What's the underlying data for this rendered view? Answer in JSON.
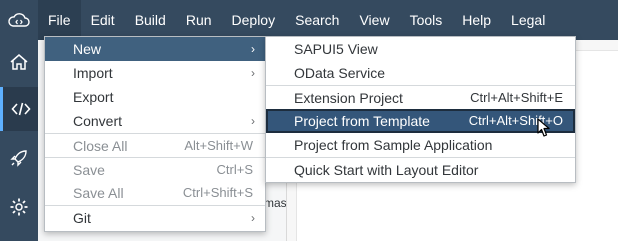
{
  "menubar": {
    "items": [
      "File",
      "Edit",
      "Build",
      "Run",
      "Deploy",
      "Search",
      "View",
      "Tools",
      "Help",
      "Legal"
    ]
  },
  "icons": {
    "logo": "cloud-code-icon",
    "sidebar": [
      "home-icon",
      "code-icon",
      "rocket-icon",
      "gear-icon"
    ]
  },
  "file_menu": {
    "new": "New",
    "import": "Import",
    "export": "Export",
    "convert": "Convert",
    "close_all": "Close All",
    "close_all_shortcut": "Alt+Shift+W",
    "save": "Save",
    "save_shortcut": "Ctrl+S",
    "save_all": "Save All",
    "save_all_shortcut": "Ctrl+Shift+S",
    "git": "Git",
    "submenu_arrow": "›"
  },
  "new_menu": {
    "sapui5_view": "SAPUI5 View",
    "odata_service": "OData Service",
    "extension_project": "Extension Project",
    "extension_project_shortcut": "Ctrl+Alt+Shift+E",
    "project_from_template": "Project from Template",
    "project_from_template_shortcut": "Ctrl+Alt+Shift+O",
    "project_from_sample": "Project from Sample Application",
    "quick_start": "Quick Start with Layout Editor"
  },
  "background": {
    "partial_text": "mas"
  },
  "colors": {
    "menubar_bg": "#354a5f",
    "highlight": "#40617f",
    "selected": "#34567a"
  }
}
